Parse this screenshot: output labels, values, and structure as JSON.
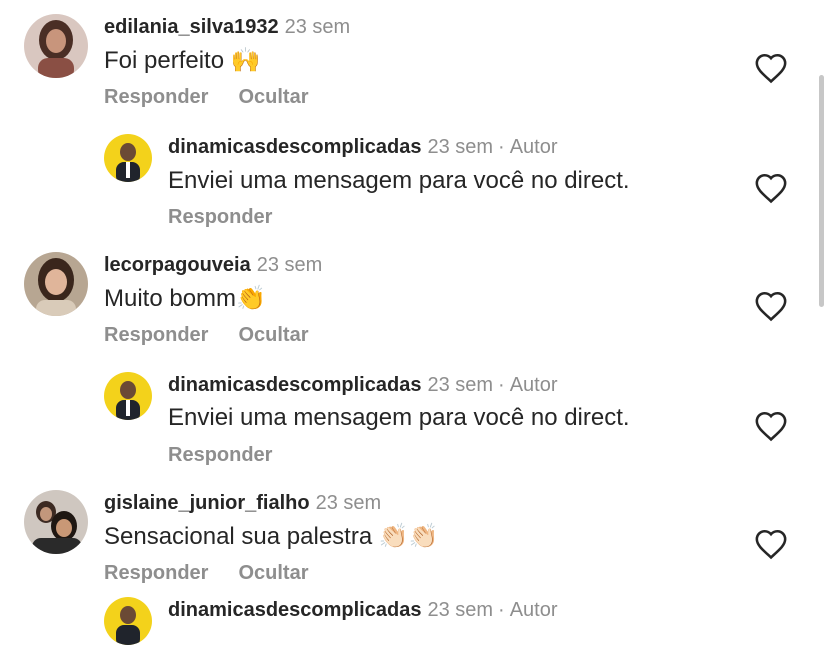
{
  "comments": [
    {
      "user": "edilania_silva1932",
      "time": "23 sem",
      "text": "Foi perfeito",
      "emoji": "🙌",
      "reply": "Responder",
      "hide": "Ocultar",
      "avatar": "avatar-woman-dark-hair"
    },
    {
      "user": "dinamicasdescomplicadas",
      "time": "23 sem",
      "author": "Autor",
      "sep": "·",
      "text": "Enviei uma mensagem para você no direct.",
      "reply": "Responder",
      "avatar": "avatar-speaker-yellow"
    },
    {
      "user": "lecorpagouveia",
      "time": "23 sem",
      "text": "Muito bomm",
      "emoji": "👏",
      "reply": "Responder",
      "hide": "Ocultar",
      "avatar": "avatar-woman-smiling"
    },
    {
      "user": "dinamicasdescomplicadas",
      "time": "23 sem",
      "author": "Autor",
      "sep": "·",
      "text": "Enviei uma mensagem para você no direct.",
      "reply": "Responder",
      "avatar": "avatar-speaker-yellow"
    },
    {
      "user": "gislaine_junior_fialho",
      "time": "23 sem",
      "text": "Sensacional sua palestra",
      "emoji": "👏🏻👏🏻",
      "reply": "Responder",
      "hide": "Ocultar",
      "avatar": "avatar-couple"
    },
    {
      "user": "dinamicasdescomplicadas",
      "time": "23 sem",
      "author": "Autor",
      "sep": "·",
      "avatar": "avatar-speaker-yellow"
    }
  ],
  "icons": {
    "like": "heart-outline-icon"
  },
  "colors": {
    "text": "#262626",
    "muted": "#8e8e8e",
    "background": "#ffffff"
  }
}
